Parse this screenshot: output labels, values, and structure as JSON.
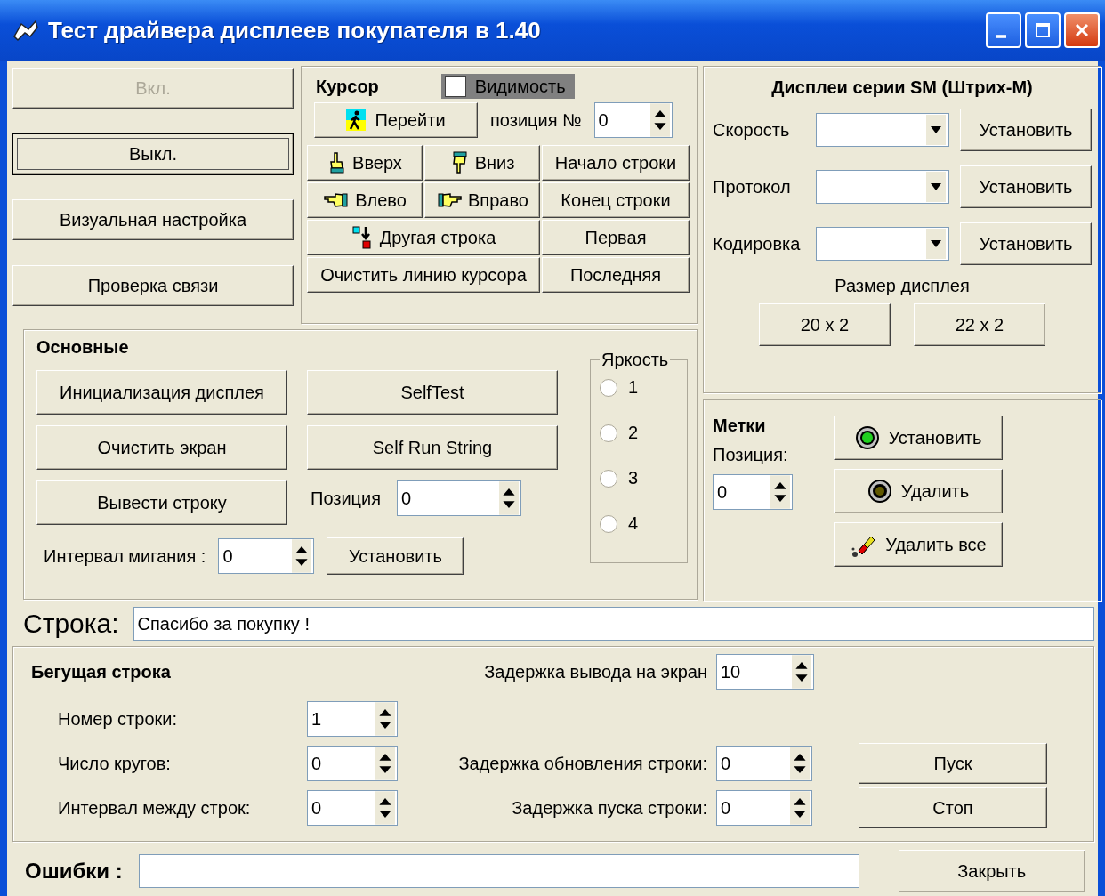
{
  "window": {
    "title": "Тест драйвера дисплеев покупателя  в 1.40"
  },
  "power_buttons": [
    {
      "label": "Вкл.",
      "disabled": true,
      "focused": false
    },
    {
      "label": "Выкл.",
      "disabled": false,
      "focused": true
    },
    {
      "label": "Визуальная настройка",
      "disabled": false,
      "focused": false
    },
    {
      "label": "Проверка связи",
      "disabled": false,
      "focused": false
    }
  ],
  "cursor": {
    "title": "Курсор",
    "visibility": {
      "label": "Видимость",
      "checked": false
    },
    "go_button": "Перейти",
    "position_label": "позиция №",
    "position_value": "0",
    "buttons": [
      {
        "label": "Вверх",
        "kind": "up",
        "wide": false
      },
      {
        "label": "Вниз",
        "kind": "down",
        "wide": false
      },
      {
        "label": "Начало строки",
        "wide": false
      },
      {
        "label": "Влево",
        "kind": "left",
        "wide": false
      },
      {
        "label": "Вправо",
        "kind": "right",
        "wide": false
      },
      {
        "label": "Конец строки",
        "wide": false
      },
      {
        "label": "Другая строка",
        "kind": "jump",
        "wide": true
      },
      {
        "label": "Первая",
        "wide": false
      },
      {
        "label": "Очистить линию курсора",
        "wide": true
      },
      {
        "label": "Последняя",
        "wide": false
      }
    ]
  },
  "sm_displays": {
    "title": "Дисплеи серии SM (Штрих-М)",
    "settings": [
      {
        "label": "Скорость",
        "button": "Установить"
      },
      {
        "label": "Протокол",
        "button": "Установить"
      },
      {
        "label": "Кодировка",
        "button": "Установить"
      }
    ],
    "size_label": "Размер дисплея",
    "size_buttons": [
      "20 x 2",
      "22 x 2"
    ]
  },
  "main": {
    "title": "Основные",
    "buttons_left": [
      "Инициализация дисплея",
      "Очистить экран",
      "Вывести строку"
    ],
    "buttons_right": [
      "SelfTest",
      "Self Run String"
    ],
    "position_label": "Позиция",
    "position_value": "0",
    "blink_label": "Интервал мигания :",
    "blink_value": "0",
    "blink_button": "Установить",
    "brightness": {
      "title": "Яркость",
      "options": [
        {
          "label": "1",
          "selected": false
        },
        {
          "label": "2",
          "selected": false
        },
        {
          "label": "3",
          "selected": false
        },
        {
          "label": "4",
          "selected": false
        }
      ]
    }
  },
  "marks": {
    "title": "Метки",
    "position_label": "Позиция:",
    "position_value": "0",
    "buttons": [
      {
        "label": "Установить",
        "kind": "set"
      },
      {
        "label": "Удалить",
        "kind": "delete"
      },
      {
        "label": "Удалить все",
        "kind": "clear"
      }
    ]
  },
  "line": {
    "label": "Строка:",
    "value": "Спасибо за покупку !"
  },
  "running_line": {
    "title": "Бегущая строка",
    "output_delay": {
      "label": "Задержка вывода на экран",
      "value": "10"
    },
    "rows": [
      {
        "label": "Номер строки:",
        "value": "1"
      },
      {
        "label": "Число кругов:",
        "value": "0",
        "right_label": "Задержка обновления строки:",
        "right_value": "0",
        "button": "Пуск"
      },
      {
        "label": "Интервал между строк:",
        "value": "0",
        "right_label": "Задержка пуска строки:",
        "right_value": "0",
        "button": "Стоп"
      }
    ]
  },
  "errors": {
    "label": "Ошибки :"
  },
  "close_button": "Закрыть"
}
